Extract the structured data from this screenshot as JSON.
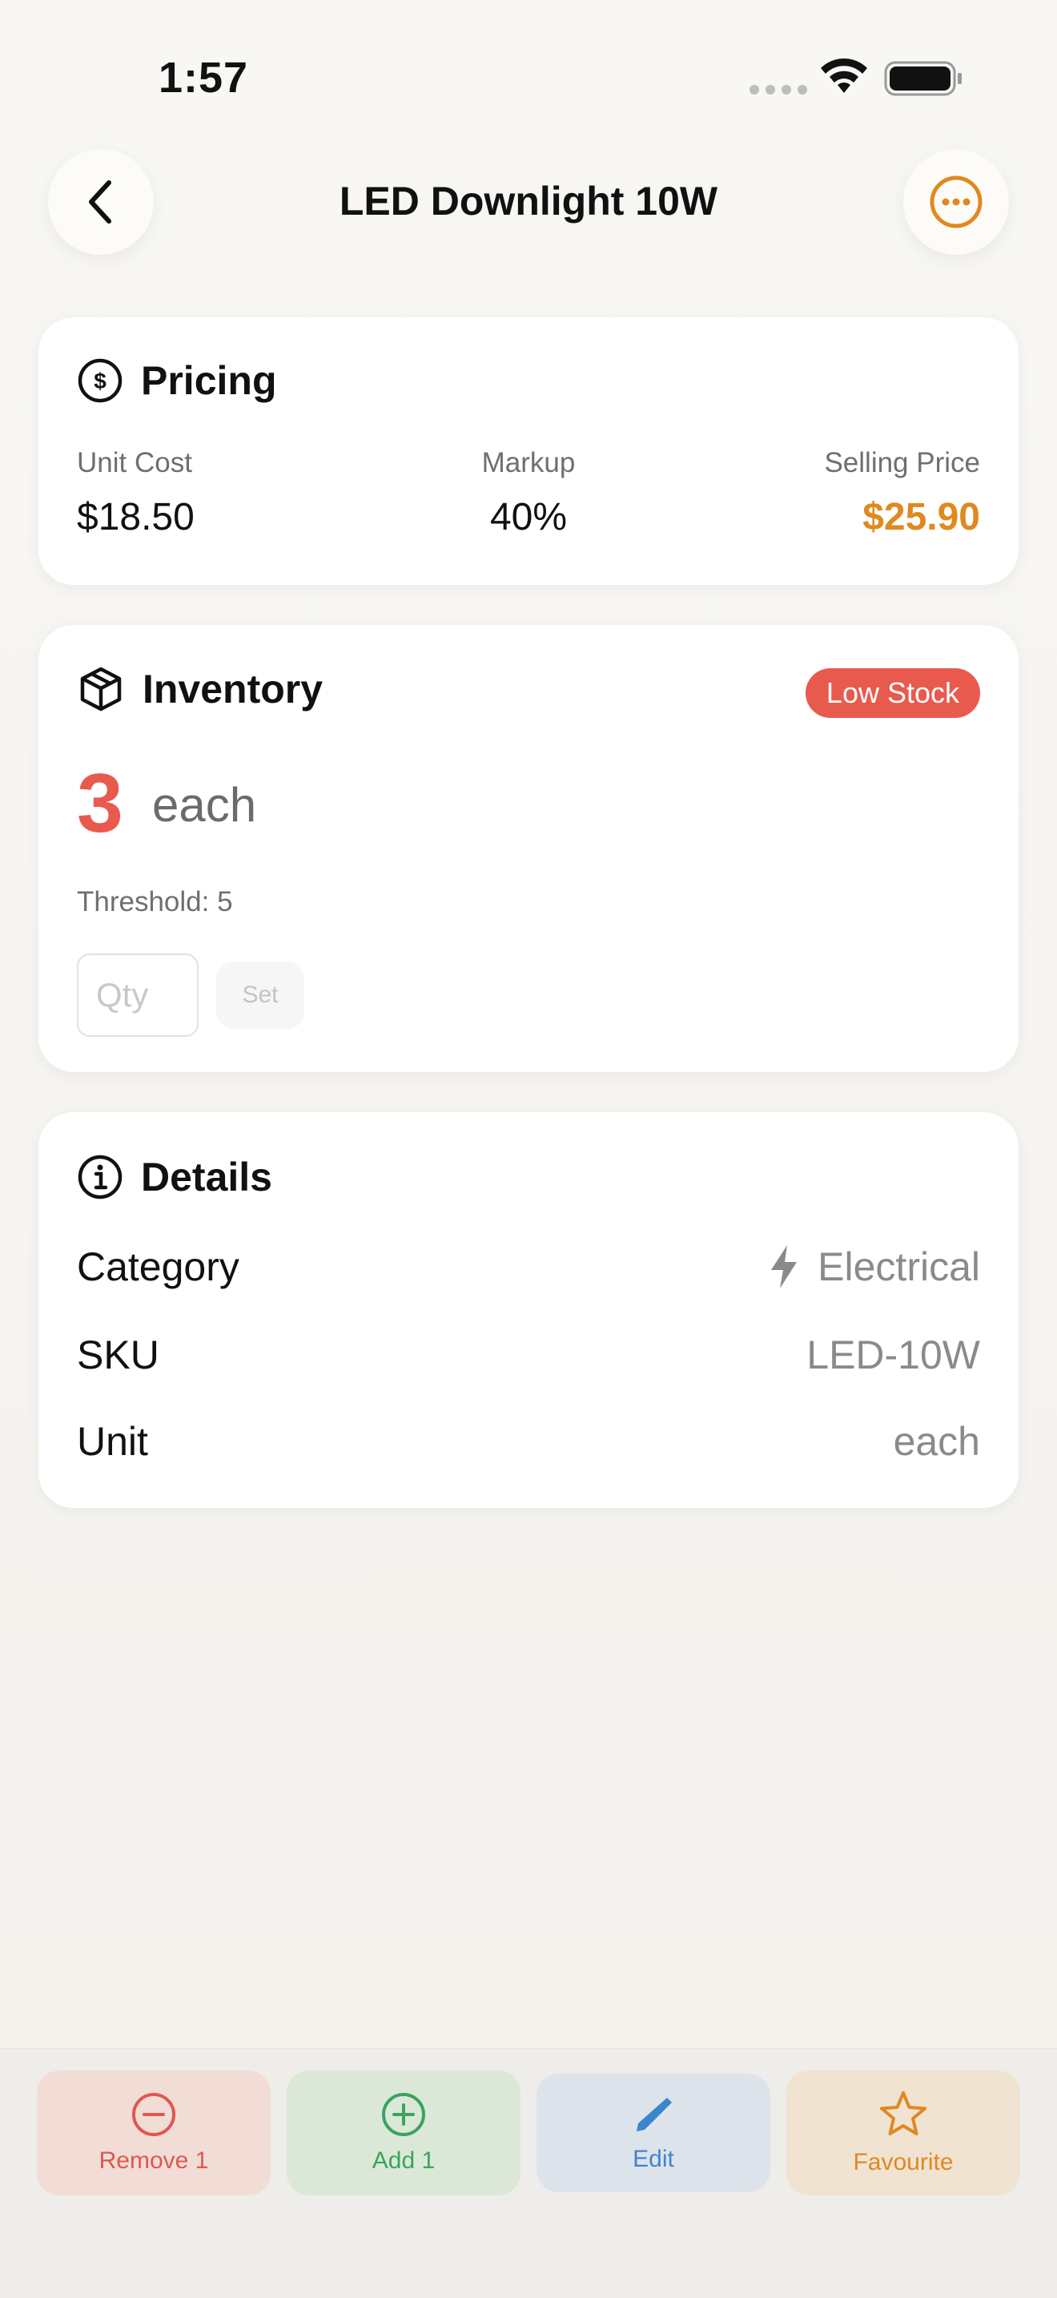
{
  "status": {
    "time": "1:57"
  },
  "nav": {
    "title": "LED Downlight 10W"
  },
  "pricing": {
    "title": "Pricing",
    "unit_cost_label": "Unit Cost",
    "unit_cost": "$18.50",
    "markup_label": "Markup",
    "markup": "40%",
    "selling_price_label": "Selling Price",
    "selling_price": "$25.90"
  },
  "inventory": {
    "title": "Inventory",
    "badge": "Low Stock",
    "quantity": "3",
    "unit": "each",
    "threshold": "Threshold: 5",
    "qty_placeholder": "Qty",
    "set_label": "Set"
  },
  "details": {
    "title": "Details",
    "rows": [
      {
        "key": "Category",
        "value": "Electrical"
      },
      {
        "key": "SKU",
        "value": "LED-10W"
      },
      {
        "key": "Unit",
        "value": "each"
      }
    ]
  },
  "actions": {
    "remove": "Remove 1",
    "add": "Add 1",
    "edit": "Edit",
    "favourite": "Favourite"
  },
  "colors": {
    "accent": "#e0891f",
    "danger": "#e95a4e",
    "success": "#3aa45f",
    "info": "#3d86cf"
  },
  "icons": {
    "back": "chevron-left-icon",
    "more": "ellipsis-circle-icon",
    "pricing": "dollar-circle-icon",
    "inventory": "box-icon",
    "details": "info-circle-icon",
    "category": "bolt-icon",
    "remove": "minus-circle-icon",
    "add": "plus-circle-icon",
    "edit": "pencil-icon",
    "favourite": "star-icon"
  }
}
